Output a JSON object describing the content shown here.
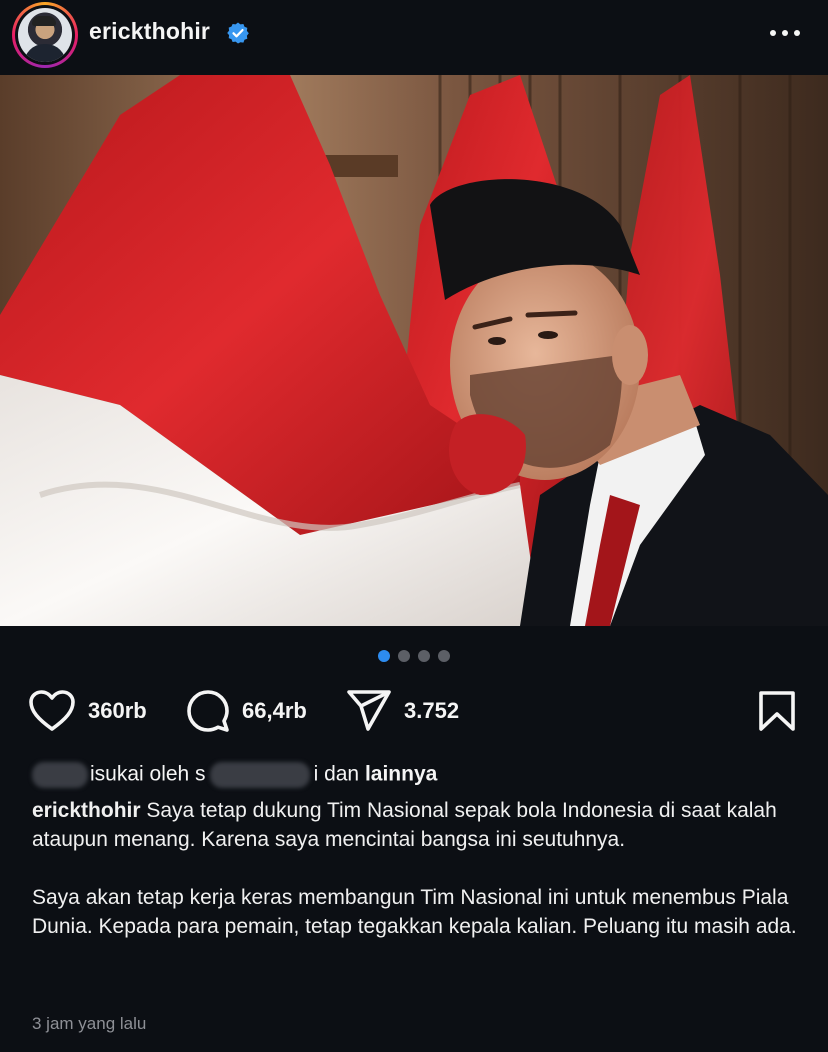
{
  "header": {
    "username": "erickthohir",
    "verified": true
  },
  "carousel": {
    "count": 4,
    "active_index": 0
  },
  "actions": {
    "likes": "360rb",
    "comments": "66,4rb",
    "shares": "3.752"
  },
  "liked_by": {
    "prefix_visible": "isukai oleh s",
    "middle_visible": "i",
    "suffix_plain": " dan ",
    "others": "lainnya"
  },
  "caption": {
    "author": "erickthohir",
    "paragraph1": "Saya tetap dukung Tim Nasional sepak bola Indonesia di saat kalah ataupun menang. Karena saya mencintai bangsa ini seutuhnya.",
    "paragraph2": "Saya akan tetap kerja keras membangun Tim Nasional ini untuk menembus Piala Dunia. Kepada para pemain, tetap tegakkan kepala kalian. Peluang itu masih ada."
  },
  "timestamp": "3 jam yang lalu",
  "colors": {
    "background": "#0c0f14",
    "accent_blue": "#2d8cf0",
    "flag_red": "#d7262b",
    "flag_white": "#f4f1ee"
  },
  "icons": [
    "heart-icon",
    "comment-icon",
    "share-icon",
    "bookmark-icon",
    "more-icon",
    "verified-icon"
  ]
}
